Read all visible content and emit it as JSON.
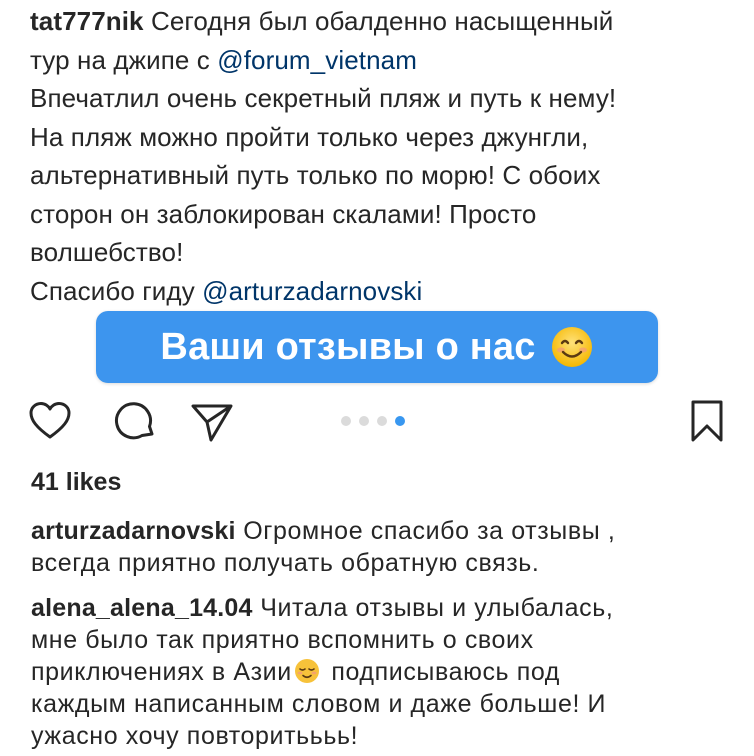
{
  "caption": {
    "username": "tat777nik",
    "line1_text": "Сегодня был обалденно насыщенный",
    "line2_text": "тур на джипе с ",
    "mention1": "@forum_vietnam",
    "line3": "Впечатлил очень секретный пляж и путь к нему!",
    "line4": "На пляж можно пройти только через джунгли,",
    "line5": "альтернативный путь только по морю! С обоих",
    "line6": "сторон он заблокирован скалами! Просто",
    "line7": "волшебство!",
    "line8_text": "Спасибо гиду ",
    "mention2": "@arturzadarnovski"
  },
  "sticker": {
    "text": "Ваши отзывы о нас",
    "emoji": "smiling-face-emoji",
    "color": "#3d95ee"
  },
  "actions": {
    "icons": [
      "heart-icon",
      "comment-icon",
      "share-icon",
      "bookmark-icon"
    ],
    "carousel": {
      "total": 4,
      "active": 4
    }
  },
  "likes": "41 likes",
  "comments": [
    {
      "username": "arturzadarnovski",
      "line1": "Огромное спасибо за отзывы ,",
      "line2": "всегда приятно получать обратную связь."
    },
    {
      "username": "alena_alena_14.04",
      "line1": "Читала отзывы и улыбалась,",
      "line2": "мне было так приятно вспомнить о своих",
      "line3a": "приключениях в Азии",
      "line3b": "подписываюсь под",
      "line4": "каждым написанным словом и даже больше! И",
      "line5": "ужасно хочу повторитьььь!"
    }
  ]
}
